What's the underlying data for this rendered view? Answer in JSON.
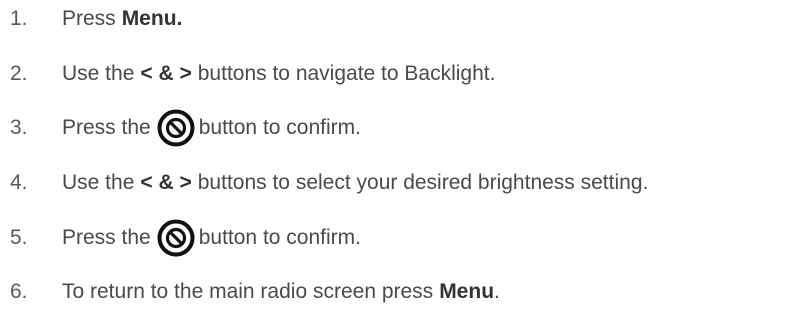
{
  "steps": [
    {
      "number": "1.",
      "before": "Press",
      "bold": "Menu.",
      "after": ""
    },
    {
      "number": "2.",
      "before": "Use the",
      "bold": "< & >",
      "after": "buttons to navigate to Backlight."
    },
    {
      "number": "3.",
      "before": "Press the",
      "icon": "confirm-button-icon",
      "after": "button to confirm."
    },
    {
      "number": "4.",
      "before": "Use the",
      "bold": "< & >",
      "after": "buttons to select your desired brightness setting."
    },
    {
      "number": "5.",
      "before": "Press the",
      "icon": "confirm-button-icon",
      "after": "button to confirm."
    },
    {
      "number": "6.",
      "before": "To return to the main radio screen press",
      "bold": "Menu",
      "after": "."
    }
  ]
}
